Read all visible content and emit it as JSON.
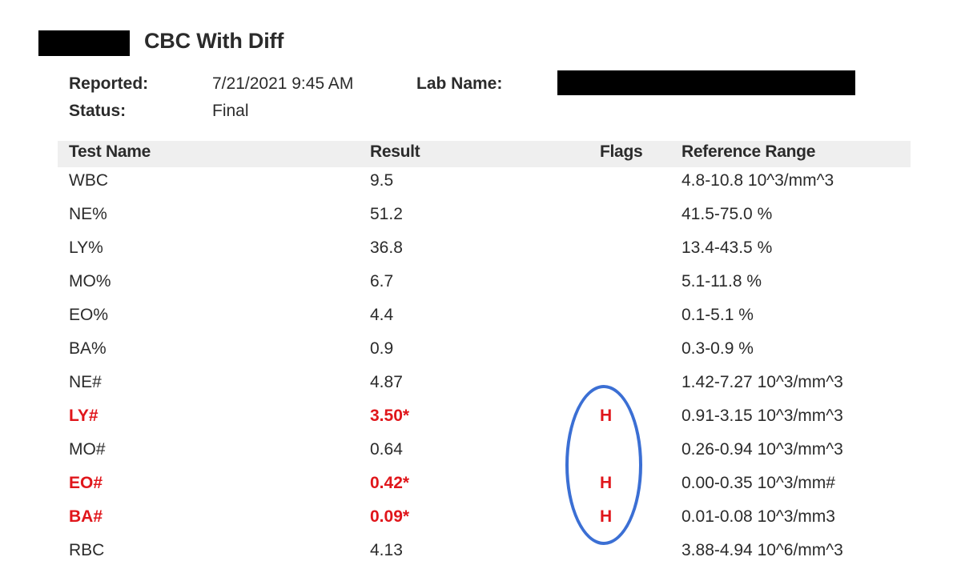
{
  "report": {
    "title": "CBC With Diff",
    "reported_label": "Reported:",
    "reported_value": "7/21/2021 9:45 AM",
    "status_label": "Status:",
    "status_value": "Final",
    "lab_name_label": "Lab Name:"
  },
  "table": {
    "headers": {
      "test_name": "Test Name",
      "result": "Result",
      "flags": "Flags",
      "reference_range": "Reference Range"
    },
    "rows": [
      {
        "name": "WBC",
        "result": "9.5",
        "flag": "",
        "range": "4.8-10.8 10^3/mm^3",
        "abnormal": false
      },
      {
        "name": "NE%",
        "result": "51.2",
        "flag": "",
        "range": "41.5-75.0 %",
        "abnormal": false
      },
      {
        "name": "LY%",
        "result": "36.8",
        "flag": "",
        "range": "13.4-43.5 %",
        "abnormal": false
      },
      {
        "name": "MO%",
        "result": "6.7",
        "flag": "",
        "range": "5.1-11.8 %",
        "abnormal": false
      },
      {
        "name": "EO%",
        "result": "4.4",
        "flag": "",
        "range": "0.1-5.1 %",
        "abnormal": false
      },
      {
        "name": "BA%",
        "result": "0.9",
        "flag": "",
        "range": "0.3-0.9 %",
        "abnormal": false
      },
      {
        "name": "NE#",
        "result": "4.87",
        "flag": "",
        "range": "1.42-7.27 10^3/mm^3",
        "abnormal": false
      },
      {
        "name": "LY#",
        "result": "3.50*",
        "flag": "H",
        "range": "0.91-3.15 10^3/mm^3",
        "abnormal": true
      },
      {
        "name": "MO#",
        "result": "0.64",
        "flag": "",
        "range": "0.26-0.94 10^3/mm^3",
        "abnormal": false
      },
      {
        "name": "EO#",
        "result": "0.42*",
        "flag": "H",
        "range": "0.00-0.35 10^3/mm#",
        "abnormal": true
      },
      {
        "name": "BA#",
        "result": "0.09*",
        "flag": "H",
        "range": "0.01-0.08 10^3/mm3",
        "abnormal": true
      },
      {
        "name": "RBC",
        "result": "4.13",
        "flag": "",
        "range": "3.88-4.94 10^6/mm^3",
        "abnormal": false
      }
    ]
  },
  "colors": {
    "flag_red": "#e0161b",
    "annotation_blue": "#3b6fd4",
    "header_bg": "#efefef",
    "redaction": "#000000"
  },
  "annotation": {
    "shape": "ellipse",
    "encircles": "flags-column-high-values"
  }
}
